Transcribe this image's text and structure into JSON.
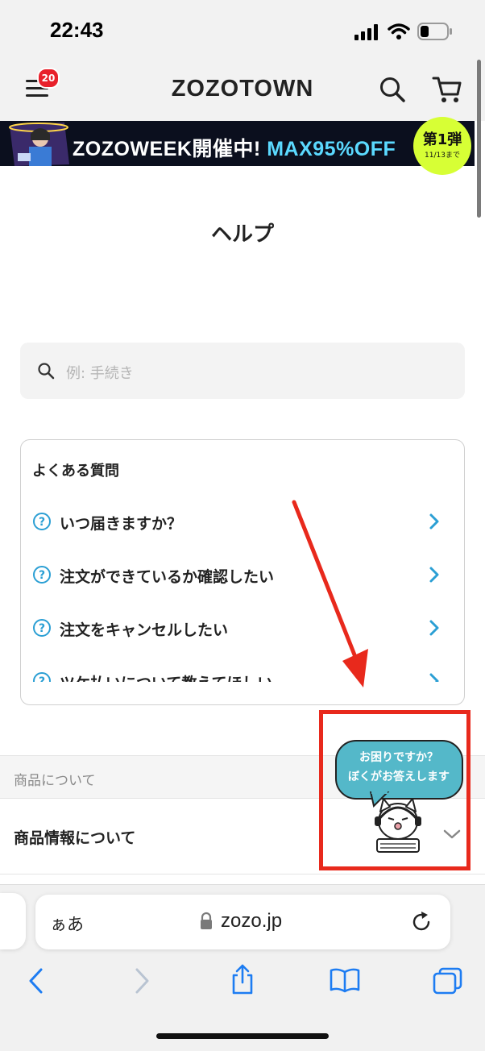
{
  "status_bar": {
    "time": "22:43"
  },
  "header": {
    "logo": "ZOZOTOWN",
    "cart_badge": "20"
  },
  "banner": {
    "text_main": "ZOZOWEEK開催中! ",
    "text_highlight": "MAX95%OFF",
    "badge_title": "第1弾",
    "badge_date": "11/13まで"
  },
  "page": {
    "title": "ヘルプ"
  },
  "search": {
    "placeholder": "例: 手続き"
  },
  "faq": {
    "title": "よくある質問",
    "items": [
      {
        "label": "いつ届きますか？"
      },
      {
        "label": "注文ができているか確認したい"
      },
      {
        "label": "注文をキャンセルしたい"
      },
      {
        "label": "ツケ払いについて教えてほしい"
      }
    ]
  },
  "sections": {
    "category_label": "商品について",
    "product_info_label": "商品情報について"
  },
  "chat_bubble": {
    "line1": "お困りですか？",
    "line2": "ぼくがお答えします"
  },
  "browser": {
    "aa_label": "ぁあ",
    "url": "zozo.jp"
  },
  "colors": {
    "accent_blue": "#2b9fd4",
    "annotation_red": "#e8291c",
    "banner_bg": "#0b0f1e",
    "banner_highlight": "#5bd9ff",
    "badge_red": "#e8212b"
  }
}
